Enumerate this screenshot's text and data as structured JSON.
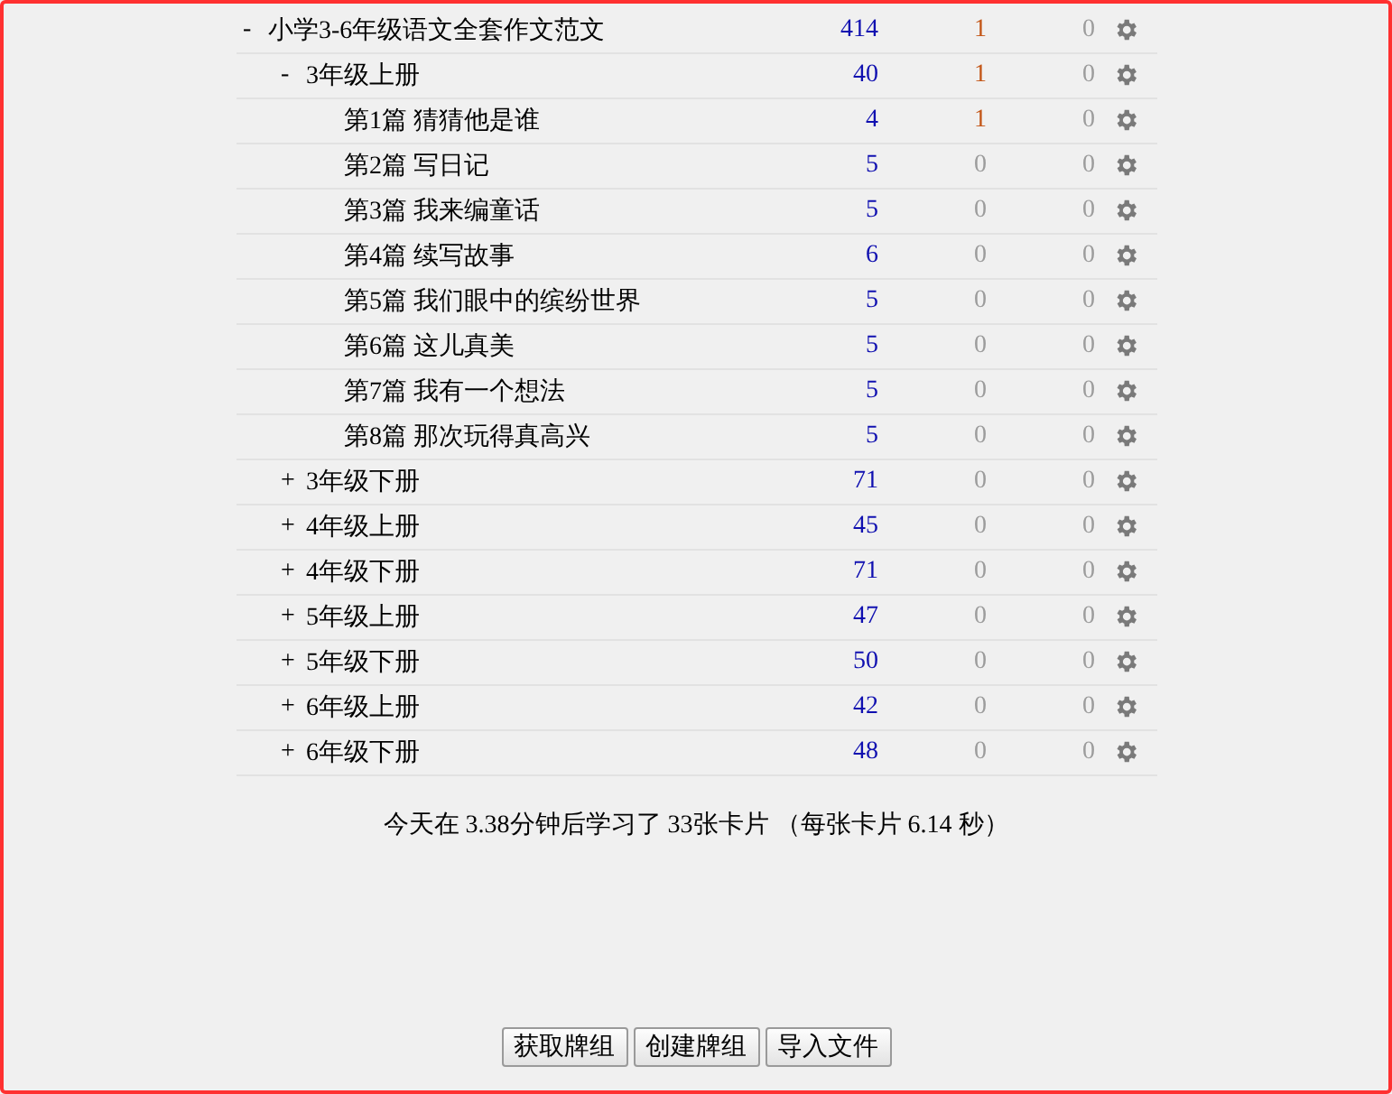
{
  "decks": [
    {
      "name": "小学3-6年级语文全套作文范文",
      "toggle": "-",
      "new": "414",
      "learn": "1",
      "due": "0",
      "children": [
        {
          "name": "3年级上册",
          "toggle": "-",
          "new": "40",
          "learn": "1",
          "due": "0",
          "children": [
            {
              "name": "第1篇 猜猜他是谁",
              "new": "4",
              "learn": "1",
              "due": "0"
            },
            {
              "name": "第2篇 写日记",
              "new": "5",
              "learn": "0",
              "due": "0"
            },
            {
              "name": "第3篇 我来编童话",
              "new": "5",
              "learn": "0",
              "due": "0"
            },
            {
              "name": "第4篇 续写故事",
              "new": "6",
              "learn": "0",
              "due": "0"
            },
            {
              "name": "第5篇 我们眼中的缤纷世界",
              "new": "5",
              "learn": "0",
              "due": "0"
            },
            {
              "name": "第6篇 这儿真美",
              "new": "5",
              "learn": "0",
              "due": "0"
            },
            {
              "name": "第7篇 我有一个想法",
              "new": "5",
              "learn": "0",
              "due": "0"
            },
            {
              "name": "第8篇 那次玩得真高兴",
              "new": "5",
              "learn": "0",
              "due": "0"
            }
          ]
        },
        {
          "name": "3年级下册",
          "toggle": "+",
          "new": "71",
          "learn": "0",
          "due": "0"
        },
        {
          "name": "4年级上册",
          "toggle": "+",
          "new": "45",
          "learn": "0",
          "due": "0"
        },
        {
          "name": "4年级下册",
          "toggle": "+",
          "new": "71",
          "learn": "0",
          "due": "0"
        },
        {
          "name": "5年级上册",
          "toggle": "+",
          "new": "47",
          "learn": "0",
          "due": "0"
        },
        {
          "name": "5年级下册",
          "toggle": "+",
          "new": "50",
          "learn": "0",
          "due": "0"
        },
        {
          "name": "6年级上册",
          "toggle": "+",
          "new": "42",
          "learn": "0",
          "due": "0"
        },
        {
          "name": "6年级下册",
          "toggle": "+",
          "new": "48",
          "learn": "0",
          "due": "0"
        }
      ]
    }
  ],
  "stats": "今天在 3.38分钟后学习了 33张卡片 （每张卡片 6.14 秒）",
  "buttons": [
    "获取牌组",
    "创建牌组",
    "导入文件"
  ]
}
